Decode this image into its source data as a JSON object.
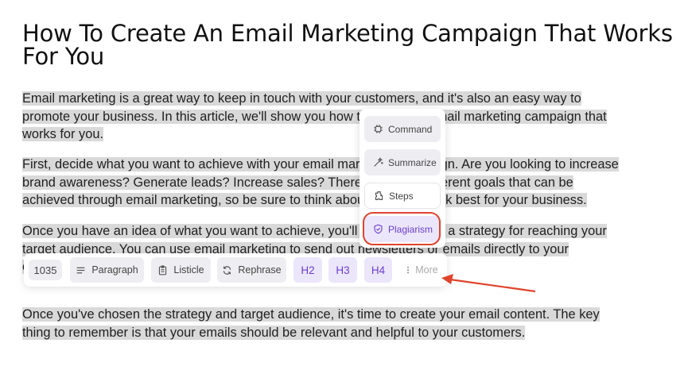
{
  "article": {
    "title": "How To Create An Email Marketing Campaign That Works For You",
    "paragraphs": [
      "Email marketing is a great way to keep in touch with your customers, and it's also an easy way to promote your business. In this article, we'll show you how to create an email marketing campaign that works for you.",
      "First, decide what you want to achieve with your email marketing campaign. Are you looking to increase brand awareness? Generate leads? Increase sales? There are many different goals that can be achieved through email marketing, so be sure to think about what will work best for your business.",
      "Once you have an idea of what you want to achieve, you'll need to create a strategy for reaching your target audience. You can use email marketing to send out newsletters or emails directly to your customers, or you can use social media tools like Hootsuite to send out",
      "Once you've chosen the strategy and target audience, it's time to create your email content. The key thing to remember is that your emails should be relevant and helpful to your customers."
    ]
  },
  "menu": {
    "items": [
      {
        "label": "Command",
        "icon": "command-icon"
      },
      {
        "label": "Summarize",
        "icon": "summarize-icon"
      },
      {
        "label": "Steps",
        "icon": "steps-icon"
      },
      {
        "label": "Plagiarism",
        "icon": "shield-check-icon",
        "highlighted": true
      }
    ]
  },
  "toolbar": {
    "word_count": "1035",
    "paragraph_label": "Paragraph",
    "listicle_label": "Listicle",
    "rephrase_label": "Rephrase",
    "h2_label": "H2",
    "h3_label": "H3",
    "h4_label": "H4",
    "more_label": "More"
  },
  "colors": {
    "accent": "#6a3fd0",
    "accent_bg": "#ece6fb",
    "highlight": "#d9d9d9",
    "annotation_red": "#e0442c"
  }
}
